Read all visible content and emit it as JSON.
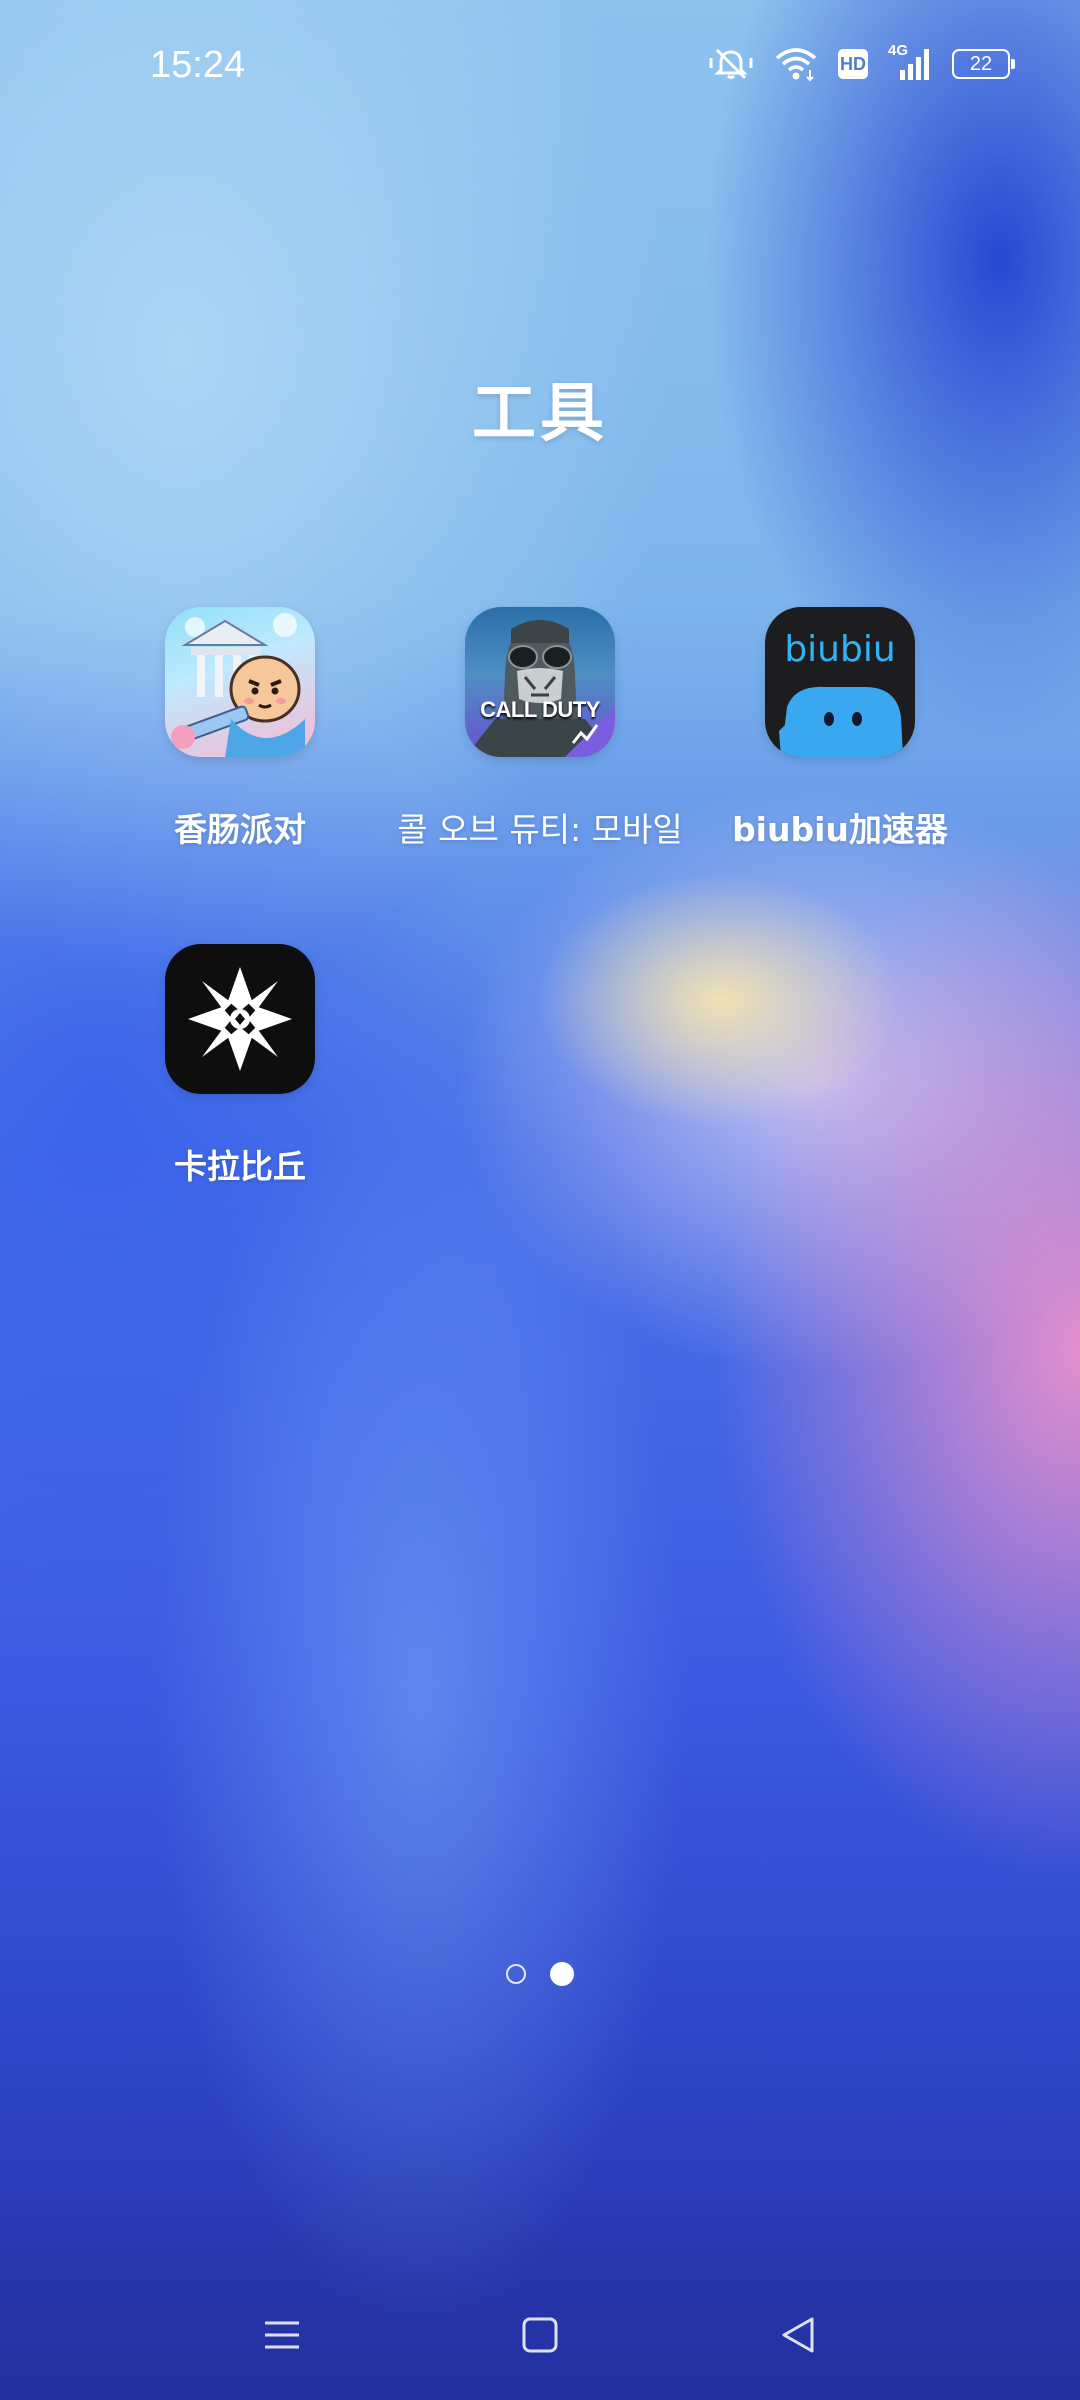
{
  "status_bar": {
    "time": "15:24",
    "icons": [
      "mute-icon",
      "wifi-icon",
      "hd-icon",
      "signal-4g-icon",
      "battery-icon"
    ],
    "hd_label": "HD",
    "network_label": "4G",
    "battery_level": "22"
  },
  "folder": {
    "title": "工具",
    "apps": [
      {
        "label": "香肠派对",
        "icon": "sausage-party-icon"
      },
      {
        "label": "콜 오브 듀티: 모바일",
        "icon": "call-of-duty-icon",
        "icon_text": "CALL DUTY"
      },
      {
        "label": "biubiu加速器",
        "icon": "biubiu-icon",
        "icon_text": "biubiu"
      },
      {
        "label": "卡拉比丘",
        "icon": "kalabiqiu-icon"
      }
    ]
  },
  "pager": {
    "pages": 2,
    "current": 2
  },
  "nav_bar": {
    "buttons": [
      "menu-icon",
      "home-icon",
      "back-icon"
    ]
  },
  "colors": {
    "accent_biubiu": "#2fb3f5",
    "background_top": "#8fc3ee",
    "background_bottom": "#232f9e"
  }
}
